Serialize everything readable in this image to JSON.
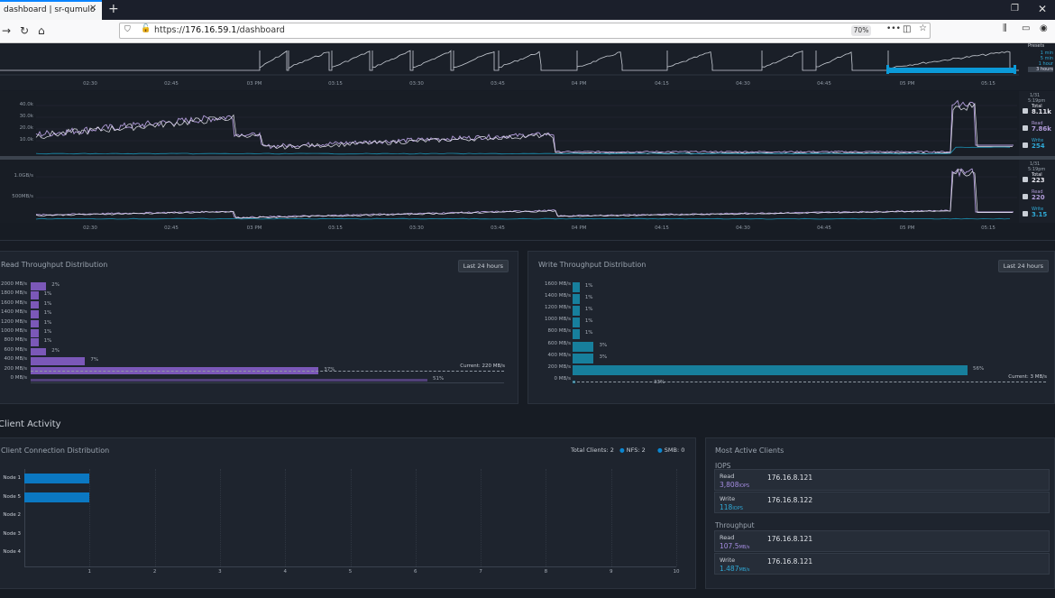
{
  "browser": {
    "tab_title": "dashboard | sr-qumulo",
    "tab_close": "✕",
    "new_tab": "+",
    "url_prefix": "https://",
    "url_host": "176.16.59.1",
    "url_path": "/dashboard",
    "zoom": "70%",
    "more": "•••"
  },
  "colors": {
    "read": "#8b6fc4",
    "write": "#1b8fb0",
    "accent": "#0b86d0",
    "bg": "#171c24"
  },
  "timeline": {
    "times": [
      "02:30",
      "02:45",
      "03 PM",
      "03:15",
      "03:30",
      "03:45",
      "04 PM",
      "04:15",
      "04:30",
      "04:45",
      "05 PM",
      "05:15"
    ],
    "presets_title": "Presets",
    "presets": [
      "1 min",
      "5 min",
      "1 hour",
      "3 hours"
    ]
  },
  "iops_chart": {
    "yticks": [
      "40.0k",
      "30.0k",
      "20.0k",
      "10.0k"
    ],
    "side_time": "1/31",
    "side_time2": "5:19pm",
    "legend": [
      {
        "label": "Total",
        "value": "8.11k"
      },
      {
        "label": "Read",
        "value": "7.86k"
      },
      {
        "label": "Write",
        "value": "254"
      }
    ]
  },
  "tput_chart": {
    "yticks": [
      "1.0GB/s",
      "500MB/s"
    ],
    "side_time": "1/31",
    "side_time2": "5:19pm",
    "legend": [
      {
        "label": "Total",
        "value": "223"
      },
      {
        "label": "Read",
        "value": "220"
      },
      {
        "label": "Write",
        "value": "3.15"
      }
    ]
  },
  "read_dist": {
    "title": "Read Throughput Distribution",
    "range_button": "Last 24 hours",
    "current": "Current: 220 MB/s",
    "chart_data": {
      "type": "bar",
      "categories": [
        "2000 MB/s",
        "1800 MB/s",
        "1600 MB/s",
        "1400 MB/s",
        "1200 MB/s",
        "1000 MB/s",
        "800 MB/s",
        "600 MB/s",
        "400 MB/s",
        "200 MB/s",
        "0 MB/s"
      ],
      "values": [
        2,
        1,
        1,
        1,
        1,
        1,
        1,
        2,
        7,
        37,
        51
      ],
      "labels": [
        "2%",
        "1%",
        "1%",
        "1%",
        "1%",
        "1%",
        "1%",
        "2%",
        "7%",
        "37%",
        "51%"
      ]
    }
  },
  "write_dist": {
    "title": "Write Throughput Distribution",
    "range_button": "Last 24 hours",
    "current": "Current: 3 MB/s",
    "chart_data": {
      "type": "bar",
      "categories": [
        "1600 MB/s",
        "1400 MB/s",
        "1200 MB/s",
        "1000 MB/s",
        "800 MB/s",
        "600 MB/s",
        "400 MB/s",
        "200 MB/s",
        "0 MB/s"
      ],
      "values": [
        1,
        1,
        1,
        1,
        1,
        3,
        3,
        56,
        33
      ],
      "labels": [
        "1%",
        "1%",
        "1%",
        "1%",
        "1%",
        "3%",
        "3%",
        "56%",
        "33%"
      ]
    }
  },
  "client_activity": {
    "heading": "Client Activity",
    "conn_title": "Client Connection Distribution",
    "total_clients": "Total Clients: 2",
    "nfs": "NFS: 2",
    "smb": "SMB: 0",
    "chart_data": {
      "type": "bar",
      "categories": [
        "Node 1",
        "Node 5",
        "Node 2",
        "Node 3",
        "Node 4"
      ],
      "values": [
        1,
        1,
        0,
        0,
        0
      ],
      "xticks": [
        "1",
        "2",
        "3",
        "4",
        "5",
        "6",
        "7",
        "8",
        "9",
        "10"
      ],
      "xlim": [
        0,
        10
      ]
    }
  },
  "most_active": {
    "title": "Most Active Clients",
    "iops_label": "IOPS",
    "throughput_label": "Throughput",
    "rows": [
      {
        "kind": "Read",
        "value": "3,808",
        "unit": "IOPS",
        "ip": "176.16.8.121",
        "color": "#a48ce0"
      },
      {
        "kind": "Write",
        "value": "118",
        "unit": "IOPS",
        "ip": "176.16.8.122",
        "color": "#2fa9d6"
      },
      {
        "kind": "Read",
        "value": "107.5",
        "unit": "MB/s",
        "ip": "176.16.8.121",
        "color": "#a48ce0"
      },
      {
        "kind": "Write",
        "value": "1.487",
        "unit": "MB/s",
        "ip": "176.16.8.121",
        "color": "#2fa9d6"
      }
    ]
  }
}
